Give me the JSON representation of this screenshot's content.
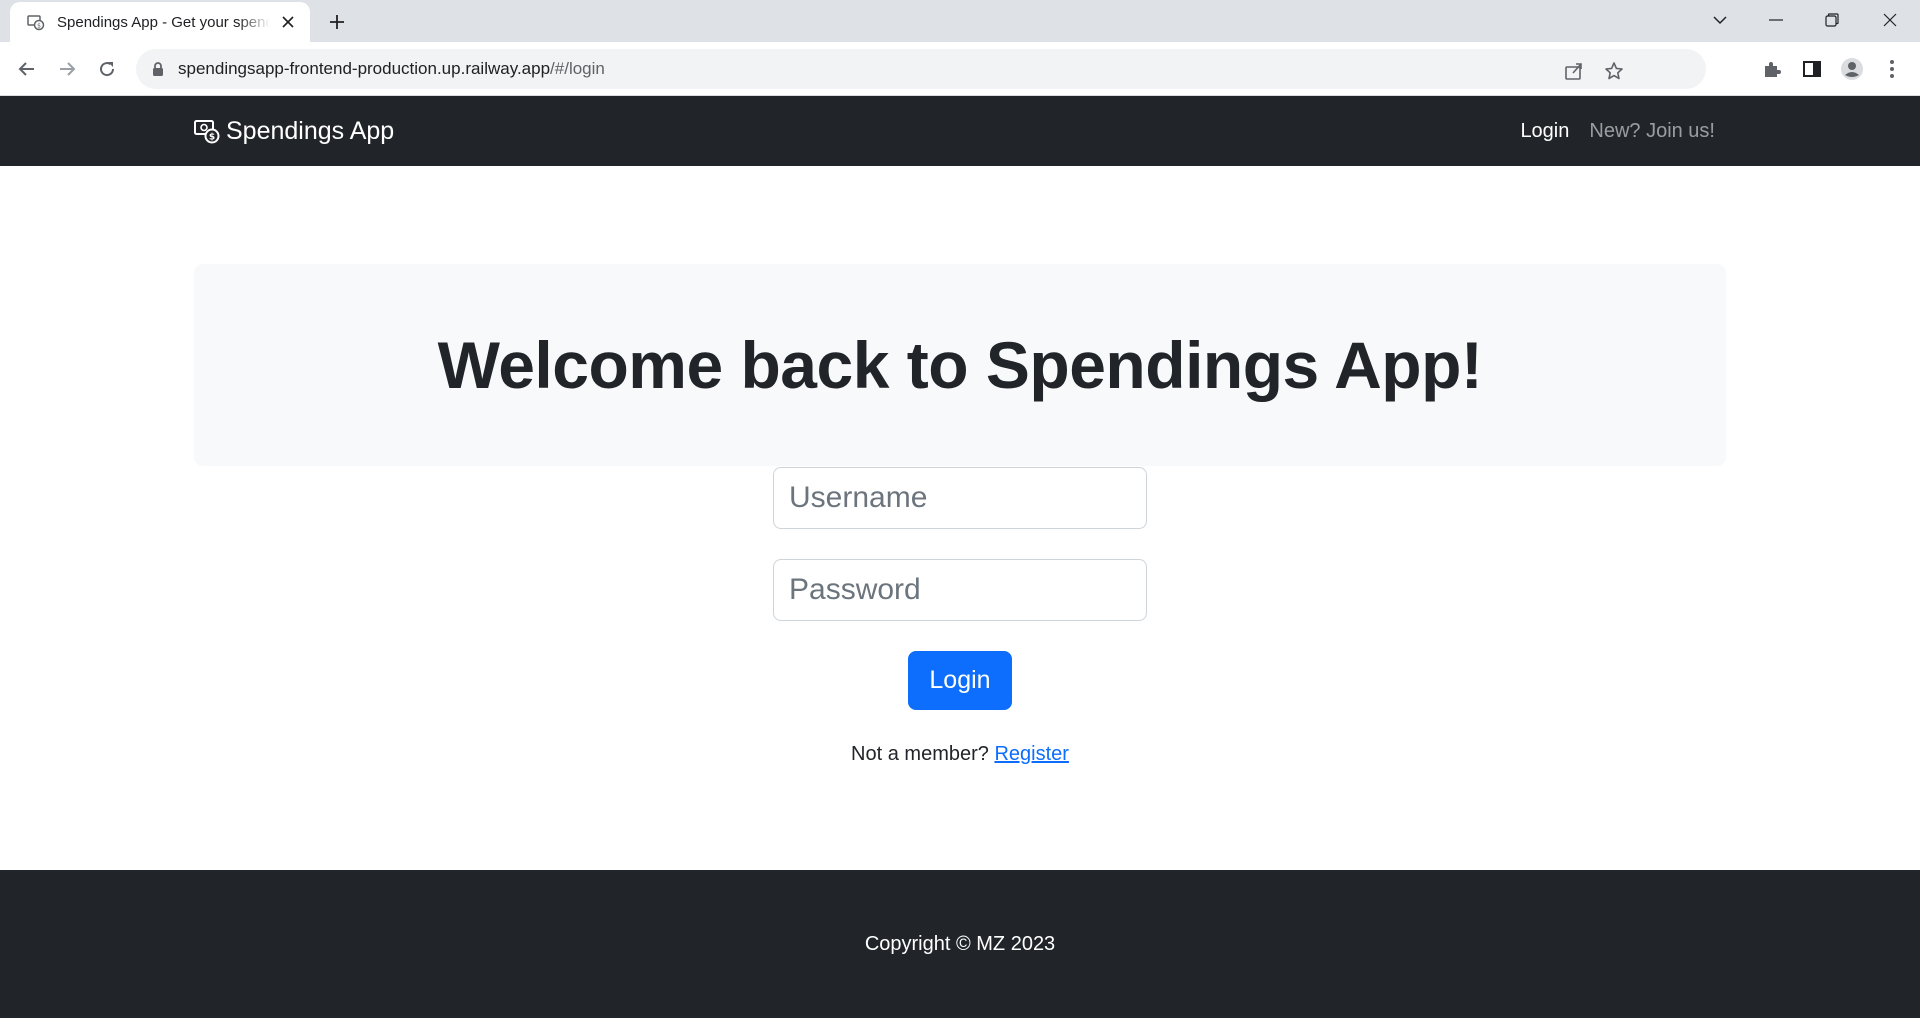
{
  "browser": {
    "tab": {
      "title": "Spendings App - Get your spendings under control"
    },
    "address_bar": {
      "url_main": "spendingsapp-frontend-production.up.railway.app",
      "url_path": "/#/login"
    },
    "icons": {
      "back": "back-arrow-icon",
      "forward": "forward-arrow-icon",
      "reload": "reload-icon",
      "lock": "lock-icon",
      "share": "share-icon",
      "bookmark": "star-icon",
      "extensions": "puzzle-icon",
      "side_panel": "side-panel-icon",
      "profile": "profile-icon",
      "menu": "kebab-menu-icon"
    }
  },
  "navbar": {
    "brand": "Spendings App",
    "links": [
      {
        "label": "Login",
        "active": true
      },
      {
        "label": "New? Join us!",
        "active": false
      }
    ]
  },
  "main": {
    "heading": "Welcome back to Spendings App!",
    "username_placeholder": "Username",
    "password_placeholder": "Password",
    "login_button": "Login",
    "register_prompt": "Not a member?",
    "register_link": "Register"
  },
  "footer": {
    "copyright": "Copyright © MZ 2023"
  },
  "colors": {
    "navbar_bg": "#212529",
    "primary": "#0d6efd",
    "hero_bg": "#f8f9fa"
  }
}
